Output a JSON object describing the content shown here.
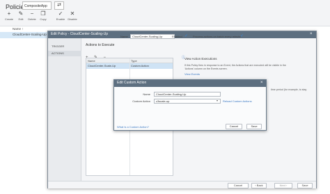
{
  "header": {
    "title": "Policies",
    "app_select_value": "CompositeApp",
    "switch_icon": "swap-icon"
  },
  "toolbar": {
    "create": "Create",
    "edit": "Edit",
    "delete": "Delete",
    "copy": "Copy",
    "enable": "Enable",
    "disable": "Disable"
  },
  "list": {
    "header": "Name",
    "sort_icon": "↑",
    "rows": [
      {
        "name": "CloudCenter-Scaling-Up"
      }
    ]
  },
  "policy_dialog": {
    "title": "Edit Policy - CloudCenter-Scaling-Up",
    "close": "×",
    "name_label": "Name",
    "name_value": "CloudCenter-Scaling-Up",
    "enabled_label": "Enabled",
    "process_label": "Process actions on batch every minute",
    "nav": [
      "TRIGGER",
      "ACTIONS"
    ],
    "actions_title": "Actions to Execute",
    "table": {
      "columns": [
        "Name",
        "Type"
      ],
      "rows": [
        {
          "name": "CloudCenter-Scale-Up",
          "type": "Custom Action"
        }
      ]
    },
    "info_title": "View Action Executions",
    "info_lines": [
      "If this Policy fires in response to an Event, the Actions that are executed will be visible in the",
      "‘Actions’ column on the Events screen."
    ],
    "view_events": "View Events",
    "info_tail": "time period (for example, to stay",
    "footer": {
      "cancel": "Cancel",
      "back": "‹ Back",
      "next": "Next ›",
      "save": "Save"
    }
  },
  "custom_action_dialog": {
    "title": "Edit Custom Action",
    "close": "×",
    "name_label": "Name",
    "name_value": "CloudCenter-Scaling-Up",
    "action_label": "Custom Action",
    "action_value": "c3scale-up",
    "reload": "Reload Custom Actions",
    "help_link": "What is a Custom Action?",
    "cancel": "Cancel",
    "save": "Save"
  }
}
